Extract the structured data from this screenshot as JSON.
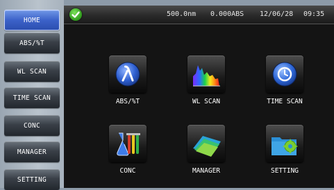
{
  "sidebar": {
    "items": [
      {
        "label": "HOME",
        "active": true
      },
      {
        "label": "ABS/%T"
      },
      {
        "label": "WL SCAN"
      },
      {
        "label": "TIME SCAN"
      },
      {
        "label": "CONC"
      },
      {
        "label": "MANAGER"
      },
      {
        "label": "SETTING"
      }
    ]
  },
  "status": {
    "wavelength": "500.0nm",
    "absorbance": "0.000ABS",
    "date": "12/06/28",
    "time": "09:35",
    "ok_icon": "check-circle-icon"
  },
  "tiles": [
    {
      "label": "ABS/%T",
      "icon": "lambda-icon"
    },
    {
      "label": "WL SCAN",
      "icon": "spectrum-icon"
    },
    {
      "label": "TIME SCAN",
      "icon": "clock-icon"
    },
    {
      "label": "CONC",
      "icon": "flask-icon"
    },
    {
      "label": "MANAGER",
      "icon": "folders-icon"
    },
    {
      "label": "SETTING",
      "icon": "gear-folder-icon"
    }
  ],
  "colors": {
    "accent": "#3c62c9",
    "ok": "#2f9a1c"
  }
}
